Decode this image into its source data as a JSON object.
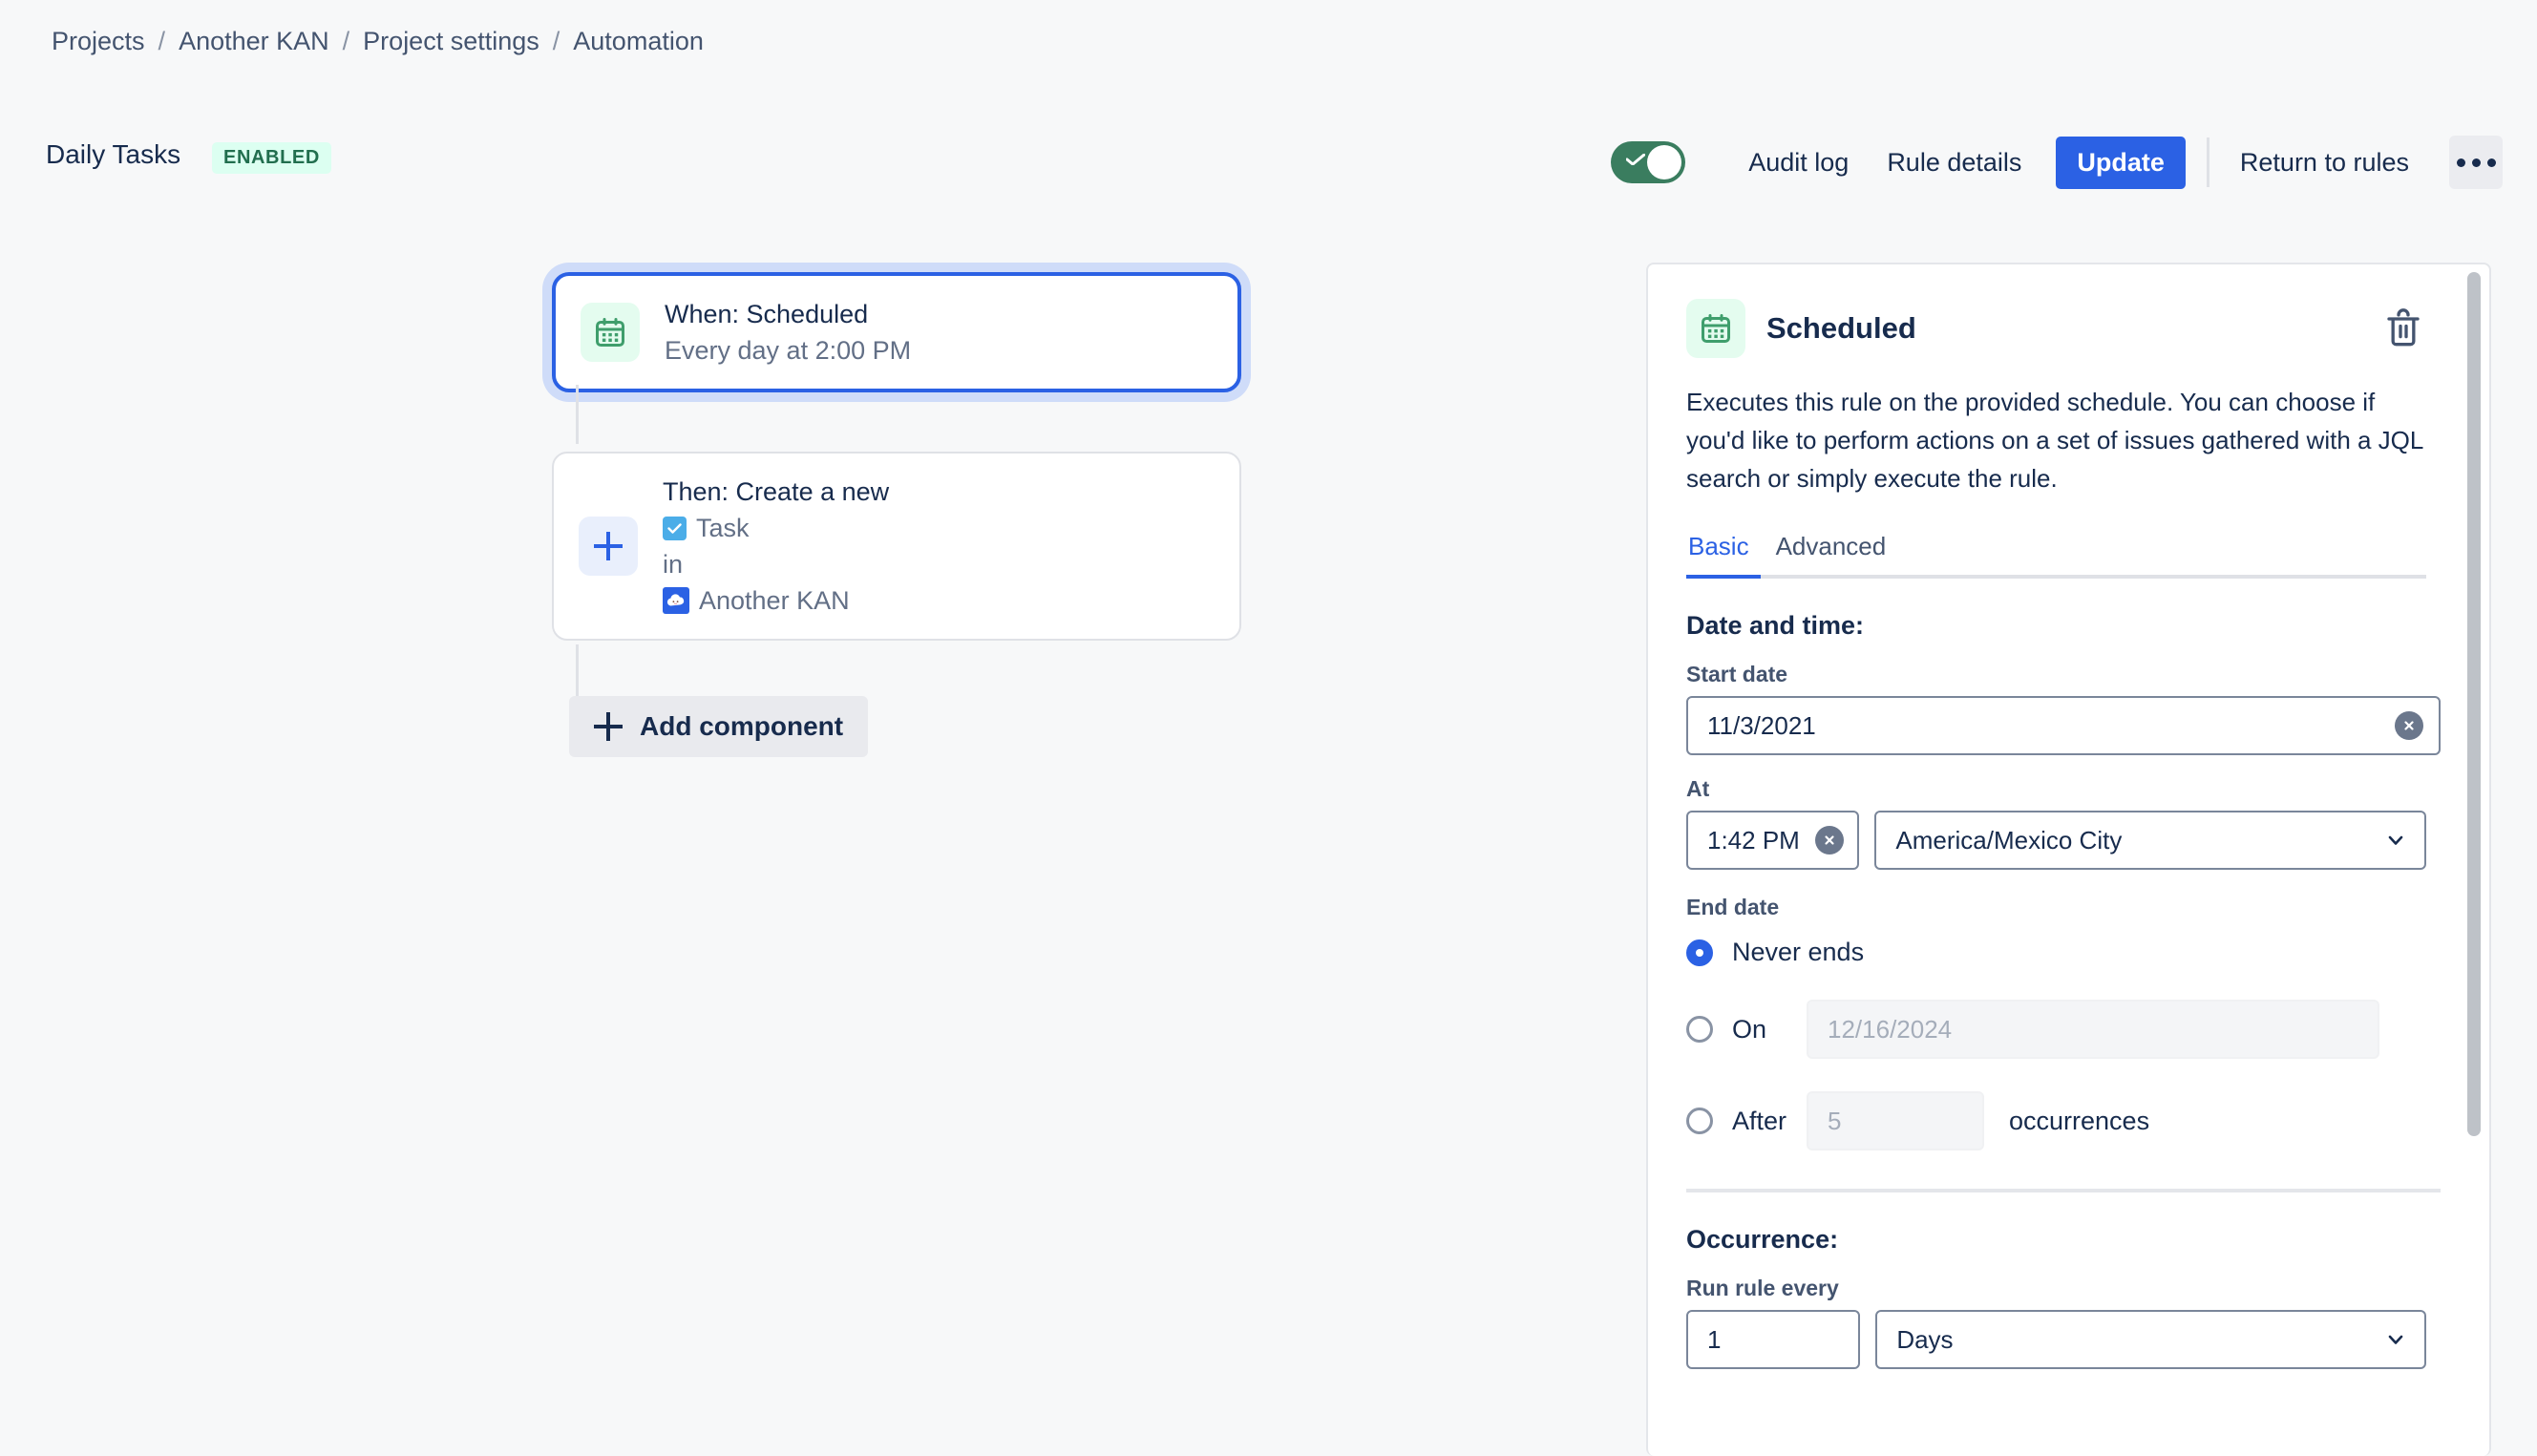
{
  "breadcrumb": {
    "items": [
      {
        "label": "Projects"
      },
      {
        "label": "Another KAN"
      },
      {
        "label": "Project settings"
      },
      {
        "label": "Automation"
      }
    ],
    "separator": "/"
  },
  "header": {
    "rule_name": "Daily Tasks",
    "status_badge": "ENABLED",
    "toggle_on": true,
    "audit_log_label": "Audit log",
    "rule_details_label": "Rule details",
    "update_label": "Update",
    "return_label": "Return to rules",
    "more_label": "More actions",
    "accent_color": "#2b61e4",
    "toggle_color": "#3a7d5f",
    "badge_bg": "#dcfff1",
    "badge_color": "#216e4e"
  },
  "flow": {
    "trigger": {
      "title": "When: Scheduled",
      "subtitle": "Every day at 2:00 PM",
      "icon": "calendar-icon",
      "selected": true
    },
    "action": {
      "title": "Then: Create a new",
      "issue_type": "Task",
      "joiner": "in",
      "project": "Another KAN",
      "icon": "plus-icon"
    },
    "add_component_label": "Add component"
  },
  "panel": {
    "title": "Scheduled",
    "icon": "calendar-icon",
    "delete_label": "Delete",
    "description": "Executes this rule on the provided schedule. You can choose if you'd like to perform actions on a set of issues gathered with a JQL search or simply execute the rule.",
    "tabs": [
      {
        "label": "Basic",
        "active": true
      },
      {
        "label": "Advanced",
        "active": false
      }
    ],
    "date_and_time": {
      "heading": "Date and time:",
      "start_date_label": "Start date",
      "start_date_value": "11/3/2021",
      "at_label": "At",
      "at_value": "1:42 PM",
      "timezone_value": "America/Mexico City",
      "end_date_label": "End date",
      "end_options": [
        {
          "label": "Never ends",
          "selected": true
        },
        {
          "label": "On",
          "selected": false,
          "placeholder": "12/16/2024"
        },
        {
          "label": "After",
          "selected": false,
          "placeholder": "5",
          "suffix": "occurrences"
        }
      ]
    },
    "occurrence": {
      "heading": "Occurrence:",
      "run_rule_every_label": "Run rule every",
      "interval_value": "1",
      "unit_value": "Days"
    }
  }
}
